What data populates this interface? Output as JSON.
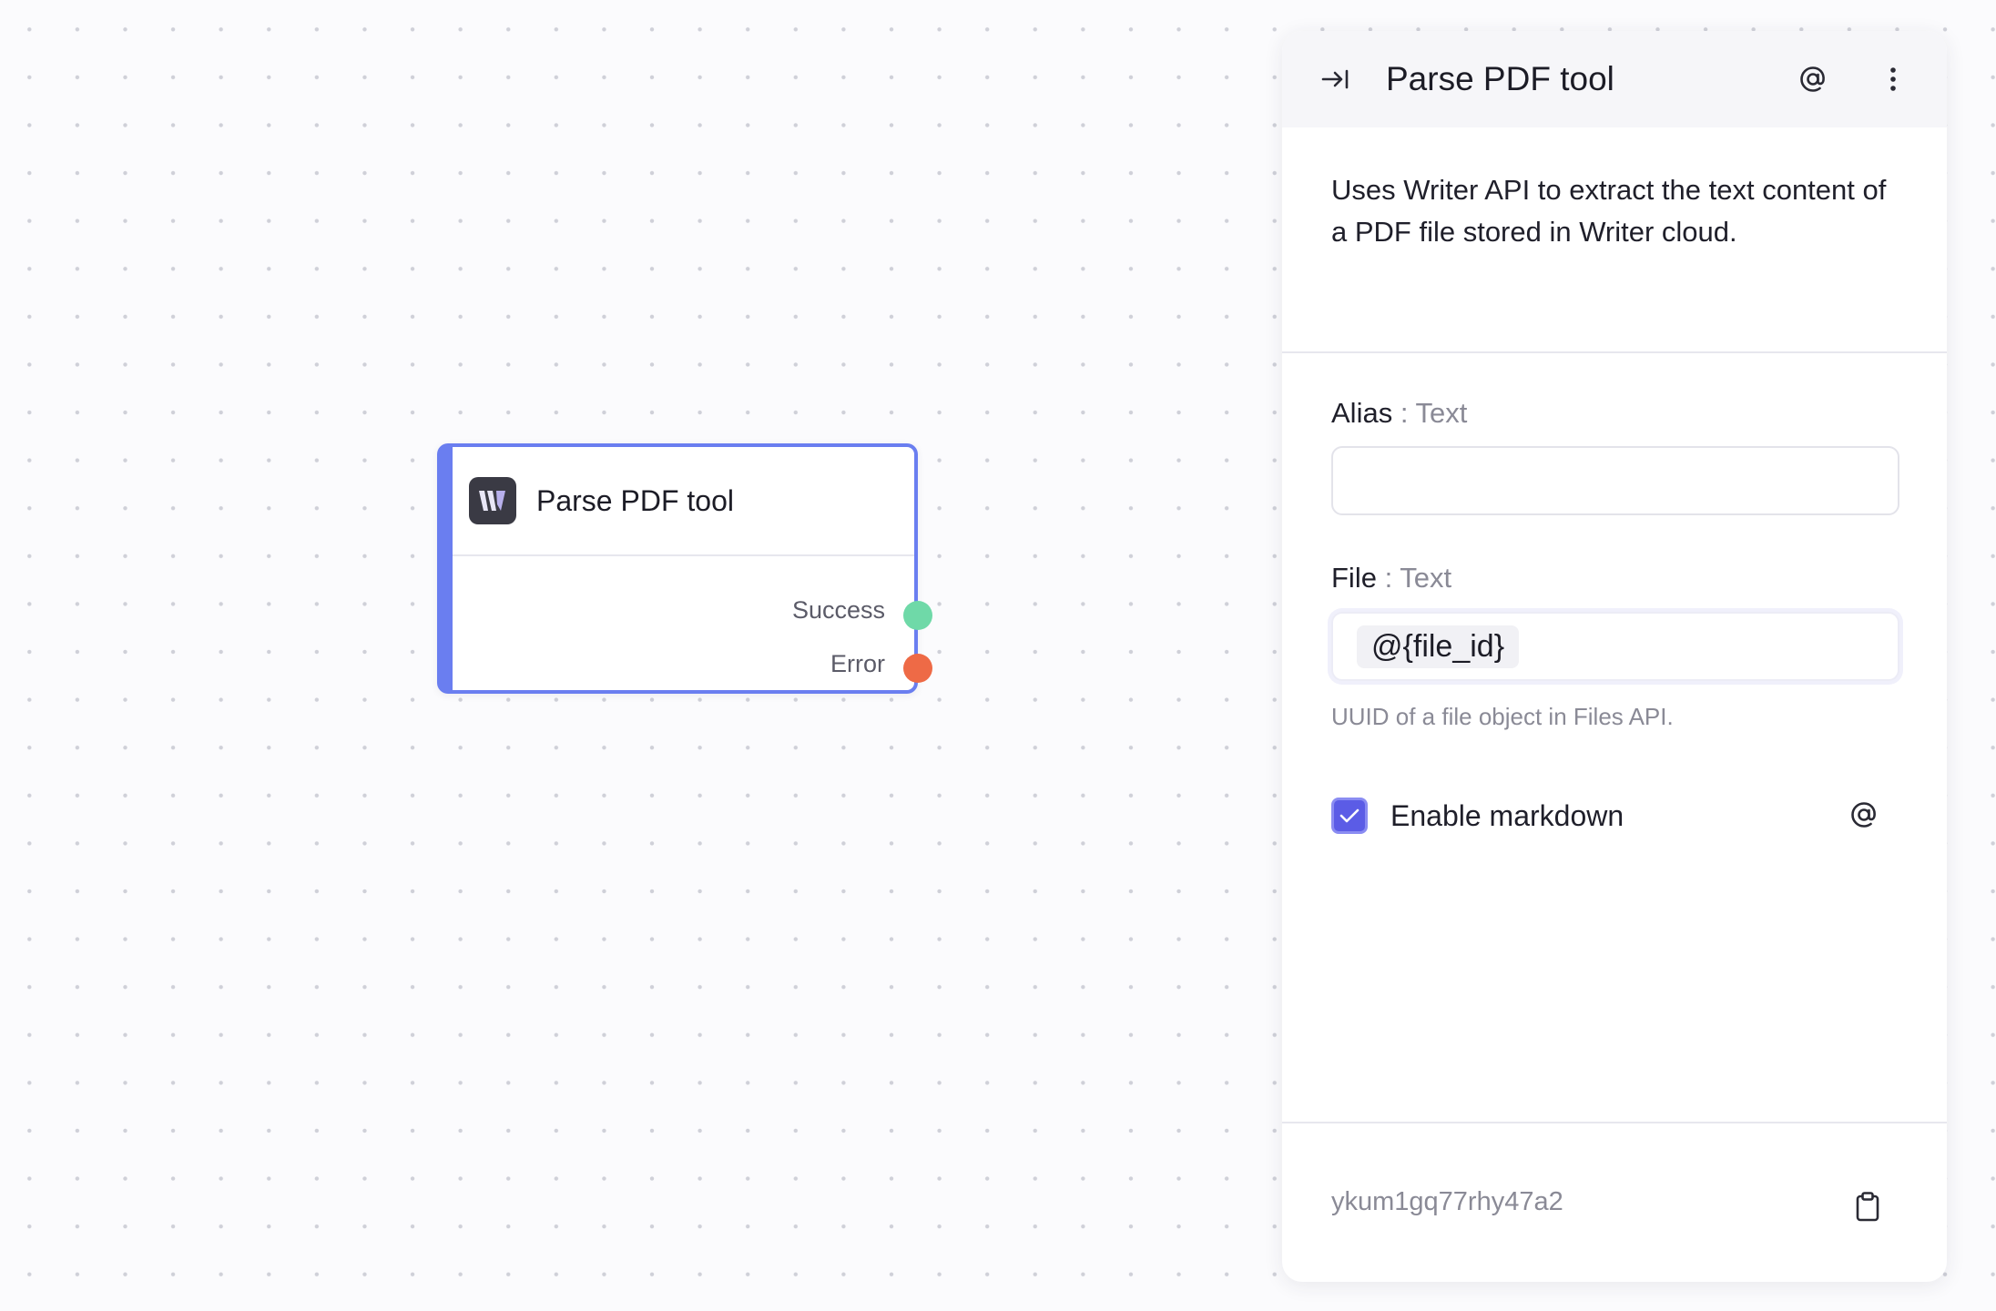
{
  "node": {
    "title": "Parse PDF tool",
    "logo_icon": "writer-logo-icon",
    "accent": "#6a7ef0",
    "outputs": [
      {
        "label": "Success",
        "color": "#6fd9a8"
      },
      {
        "label": "Error",
        "color": "#ee6a46"
      }
    ]
  },
  "panel": {
    "title": "Parse PDF tool",
    "collapse_icon": "collapse-panel-icon",
    "mention_icon": "at-icon",
    "more_icon": "more-vertical-icon",
    "description": "Uses Writer API to extract the text content of a PDF file stored in Writer cloud.",
    "fields": [
      {
        "label": "Alias",
        "type": "Text",
        "value": "",
        "help": ""
      },
      {
        "label": "File",
        "type": "Text",
        "value": "@{file_id}",
        "help": "UUID of a file object in Files API."
      }
    ],
    "checkbox": {
      "label": "Enable markdown",
      "checked": true,
      "color": "#5b5ce6"
    },
    "footer": {
      "id": "ykum1gq77rhy47a2",
      "copy_icon": "clipboard-icon"
    }
  }
}
